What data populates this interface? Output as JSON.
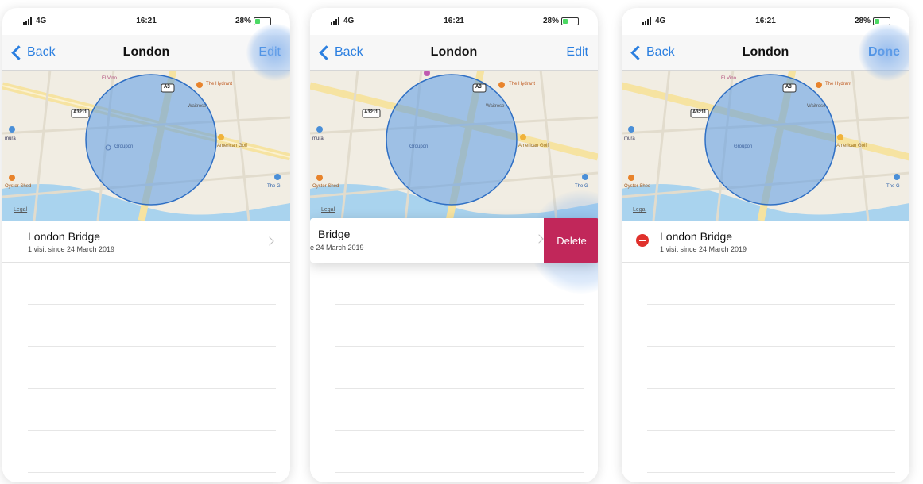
{
  "status": {
    "carrier": "4G",
    "time": "16:21",
    "battery": "28%"
  },
  "screens": [
    {
      "back": "Back",
      "title": "London",
      "action": "Edit"
    },
    {
      "back": "Back",
      "title": "London",
      "action": "Edit"
    },
    {
      "back": "Back",
      "title": "London",
      "action": "Done"
    }
  ],
  "map": {
    "road_a3": "A3",
    "road_a3211": "A3211",
    "poi_vine": "El Vino",
    "poi_hydrant": "The Hydrant",
    "poi_waitrose": "Waitrose",
    "poi_groupon": "Groupon",
    "poi_american": "American Golf",
    "poi_oyster": "Oyster Shed",
    "poi_ura": "mura",
    "poi_theg": "The G",
    "legal": "Legal"
  },
  "place": {
    "name": "London Bridge",
    "subtitle": "1 visit since 24 March 2019"
  },
  "swipe": {
    "name_cut": "Bridge",
    "subtitle_cut": "e 24 March 2019",
    "delete_label": "Delete"
  },
  "colors": {
    "accent": "#2b7fe0",
    "delete": "#c1275a",
    "minus": "#e0312c"
  }
}
